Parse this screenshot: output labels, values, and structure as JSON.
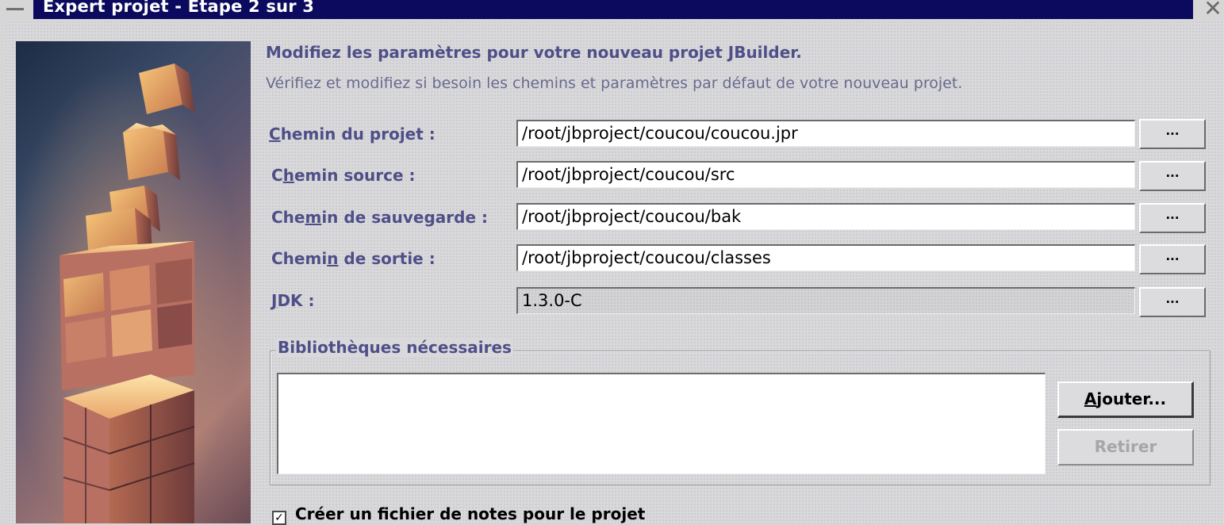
{
  "window": {
    "title": "Expert projet - Etape 2 sur 3"
  },
  "intro": {
    "title": "Modifiez les paramètres pour votre nouveau projet JBuilder.",
    "description": "Vérifiez et modifiez si besoin les chemins et paramètres par défaut de votre nouveau projet."
  },
  "fields": [
    {
      "label_pre": "",
      "label_mnemonic": "C",
      "label_post": "hemin du projet :",
      "value": "/root/jbproject/coucou/coucou.jpr",
      "button": "..."
    },
    {
      "label_pre": "C",
      "label_mnemonic": "h",
      "label_post": "emin source :",
      "value": "/root/jbproject/coucou/src",
      "button": "..."
    },
    {
      "label_pre": "Che",
      "label_mnemonic": "m",
      "label_post": "in de sauvegarde :",
      "value": "/root/jbproject/coucou/bak",
      "button": "..."
    },
    {
      "label_pre": "Chemi",
      "label_mnemonic": "n",
      "label_post": " de sortie :",
      "value": "/root/jbproject/coucou/classes",
      "button": "..."
    },
    {
      "label_pre": "",
      "label_mnemonic": "J",
      "label_post": "DK :",
      "value": "1.3.0-C",
      "button": "..."
    }
  ],
  "libraries": {
    "legend": "Bibliothèques nécessaires",
    "add_pre": "",
    "add_mnemonic": "A",
    "add_post": "jouter...",
    "remove_label": "Retirer"
  },
  "notes": {
    "checked": true,
    "check_mark": "✓",
    "label": "Créer un fichier de notes pour le projet"
  }
}
